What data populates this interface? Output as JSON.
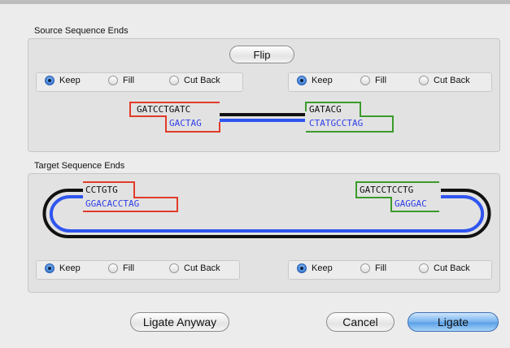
{
  "source": {
    "label": "Source Sequence Ends",
    "flip_label": "Flip",
    "left_options": {
      "keep": "Keep",
      "fill": "Fill",
      "cutback": "Cut Back"
    },
    "right_options": {
      "keep": "Keep",
      "fill": "Fill",
      "cutback": "Cut Back"
    },
    "left_top": "GATCCTGATC",
    "left_bottom": "GACTAG",
    "right_top": "GATACG",
    "right_bottom": "CTATGCCTAG"
  },
  "target": {
    "label": "Target Sequence Ends",
    "left_options": {
      "keep": "Keep",
      "fill": "Fill",
      "cutback": "Cut Back"
    },
    "right_options": {
      "keep": "Keep",
      "fill": "Fill",
      "cutback": "Cut Back"
    },
    "left_top": "CCTGTG",
    "left_bottom": "GGACACCTAG",
    "right_top": "GATCCTCCTG",
    "right_bottom": "GAGGAC"
  },
  "buttons": {
    "ligate_anyway": "Ligate Anyway",
    "cancel": "Cancel",
    "ligate": "Ligate"
  },
  "colors": {
    "red_box": "#e23b2a",
    "green_box": "#3b9b2b",
    "strand_black": "#111111",
    "strand_blue": "#2f55f0",
    "selected_radio": "#3a7fd8"
  }
}
